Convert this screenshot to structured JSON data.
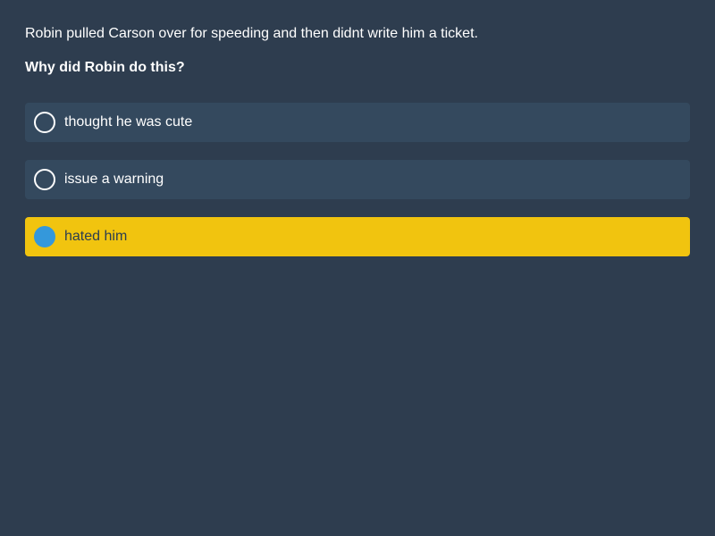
{
  "context": "Robin pulled Carson over for speeding and then didnt write him a ticket.",
  "question": "Why did Robin do this?",
  "options": [
    {
      "label": "thought he was cute",
      "selected": false
    },
    {
      "label": "issue a warning",
      "selected": false
    },
    {
      "label": "hated him",
      "selected": true
    }
  ],
  "colors": {
    "background": "#2e3d4f",
    "option_background": "#34495e",
    "selected_background": "#f1c40f",
    "selected_radio": "#3498db"
  }
}
